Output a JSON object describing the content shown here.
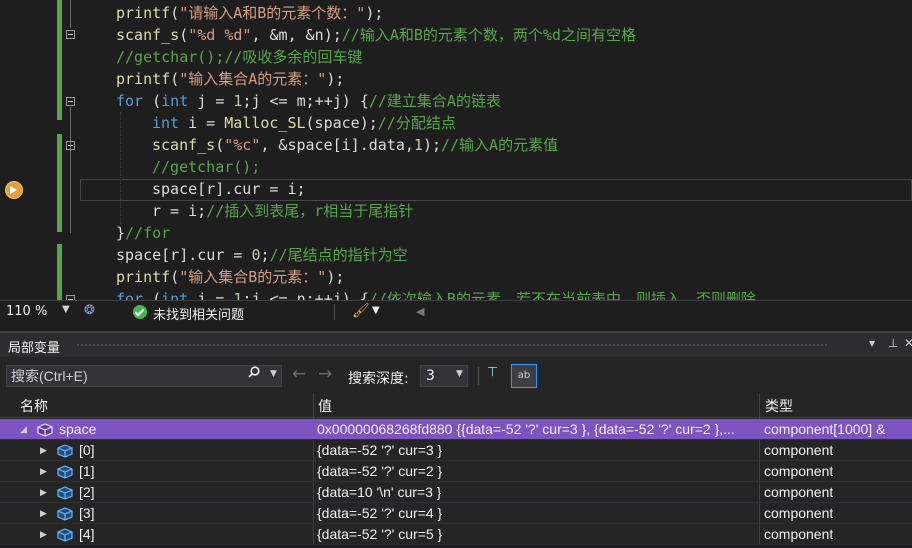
{
  "editor": {
    "lines": [
      {
        "indent": 0,
        "tokens": [
          {
            "c": "fn",
            "t": "printf"
          },
          {
            "c": "",
            "t": "("
          },
          {
            "c": "str",
            "t": "\"请输入A和B的元素个数：\""
          },
          {
            "c": "",
            "t": ");"
          }
        ]
      },
      {
        "indent": 0,
        "tokens": [
          {
            "c": "fn",
            "t": "scanf_s"
          },
          {
            "c": "",
            "t": "("
          },
          {
            "c": "str",
            "t": "\"%d %d\""
          },
          {
            "c": "",
            "t": ", &m, &n);"
          },
          {
            "c": "cmt",
            "t": "//输入A和B的元素个数，两个%d之间有空格"
          }
        ]
      },
      {
        "indent": 0,
        "tokens": [
          {
            "c": "cmt",
            "t": "//getchar();//吸收多余的回车键"
          }
        ]
      },
      {
        "indent": 0,
        "tokens": [
          {
            "c": "fn",
            "t": "printf"
          },
          {
            "c": "",
            "t": "("
          },
          {
            "c": "str",
            "t": "\"输入集合A的元素：\""
          },
          {
            "c": "",
            "t": ");"
          }
        ]
      },
      {
        "indent": 0,
        "tokens": [
          {
            "c": "kw",
            "t": "for"
          },
          {
            "c": "",
            "t": " ("
          },
          {
            "c": "kw",
            "t": "int"
          },
          {
            "c": "",
            "t": " j = "
          },
          {
            "c": "num",
            "t": "1"
          },
          {
            "c": "",
            "t": ";j <= m;++j) {"
          },
          {
            "c": "cmt",
            "t": "//建立集合A的链表"
          }
        ]
      },
      {
        "indent": 1,
        "tokens": [
          {
            "c": "kw",
            "t": "int"
          },
          {
            "c": "",
            "t": " i = "
          },
          {
            "c": "fn",
            "t": "Malloc_SL"
          },
          {
            "c": "",
            "t": "(space);"
          },
          {
            "c": "cmt",
            "t": "//分配结点"
          }
        ]
      },
      {
        "indent": 1,
        "tokens": [
          {
            "c": "fn",
            "t": "scanf_s"
          },
          {
            "c": "",
            "t": "("
          },
          {
            "c": "str",
            "t": "\"%c\""
          },
          {
            "c": "",
            "t": ", &space[i].data,"
          },
          {
            "c": "num",
            "t": "1"
          },
          {
            "c": "",
            "t": ");"
          },
          {
            "c": "cmt",
            "t": "//输入A的元素值"
          }
        ]
      },
      {
        "indent": 1,
        "tokens": [
          {
            "c": "cmt",
            "t": "//getchar();"
          }
        ]
      },
      {
        "indent": 1,
        "tokens": [
          {
            "c": "",
            "t": "space[r].cur = i;"
          }
        ]
      },
      {
        "indent": 1,
        "tokens": [
          {
            "c": "",
            "t": "r = i;"
          },
          {
            "c": "cmt",
            "t": "//插入到表尾，r相当于尾指针"
          }
        ]
      },
      {
        "indent": 0,
        "tokens": [
          {
            "c": "",
            "t": "}"
          },
          {
            "c": "cmt",
            "t": "//for"
          }
        ]
      },
      {
        "indent": 0,
        "tokens": [
          {
            "c": "",
            "t": "space[r].cur = "
          },
          {
            "c": "num",
            "t": "0"
          },
          {
            "c": "",
            "t": ";"
          },
          {
            "c": "cmt",
            "t": "//尾结点的指针为空"
          }
        ]
      },
      {
        "indent": 0,
        "tokens": [
          {
            "c": "fn",
            "t": "printf"
          },
          {
            "c": "",
            "t": "("
          },
          {
            "c": "str",
            "t": "\"输入集合B的元素：\""
          },
          {
            "c": "",
            "t": ");"
          }
        ]
      },
      {
        "indent": 0,
        "tokens": [
          {
            "c": "kw",
            "t": "for"
          },
          {
            "c": "",
            "t": " ("
          },
          {
            "c": "kw",
            "t": "int"
          },
          {
            "c": "",
            "t": " j = "
          },
          {
            "c": "num",
            "t": "1"
          },
          {
            "c": "",
            "t": ";j <= n;++j) {"
          },
          {
            "c": "cmt",
            "t": "//依次输入B的元素，若不在当前表中，则插入，否则删除"
          }
        ]
      }
    ]
  },
  "status": {
    "zoom": "110 %",
    "issues": "未找到相关问题"
  },
  "locals": {
    "title": "局部变量",
    "search_placeholder": "搜索(Ctrl+E)",
    "depth_label": "搜索深度:",
    "depth_value": "3",
    "hex_label": "ab",
    "columns": {
      "name": "名称",
      "value": "值",
      "type": "类型"
    },
    "rows": [
      {
        "level": 0,
        "expanded": true,
        "name": "space",
        "value": "0x00000068268fd880 {{data=-52 '?' cur=3 }, {data=-52 '?' cur=2 },...",
        "type": "component[1000] &",
        "selected": true
      },
      {
        "level": 1,
        "expanded": false,
        "name": "[0]",
        "value": "{data=-52 '?' cur=3 }",
        "type": "component",
        "selected": false
      },
      {
        "level": 1,
        "expanded": false,
        "name": "[1]",
        "value": "{data=-52 '?' cur=2 }",
        "type": "component",
        "selected": false
      },
      {
        "level": 1,
        "expanded": false,
        "name": "[2]",
        "value": "{data=10 '\\n' cur=3 }",
        "type": "component",
        "selected": false
      },
      {
        "level": 1,
        "expanded": false,
        "name": "[3]",
        "value": "{data=-52 '?' cur=4 }",
        "type": "component",
        "selected": false
      },
      {
        "level": 1,
        "expanded": false,
        "name": "[4]",
        "value": "{data=-52 '?' cur=5 }",
        "type": "component",
        "selected": false
      }
    ]
  },
  "colors": {
    "selection": "#7d52c1",
    "accent": "#3399ff",
    "breakpoint": "#e5a03a"
  }
}
